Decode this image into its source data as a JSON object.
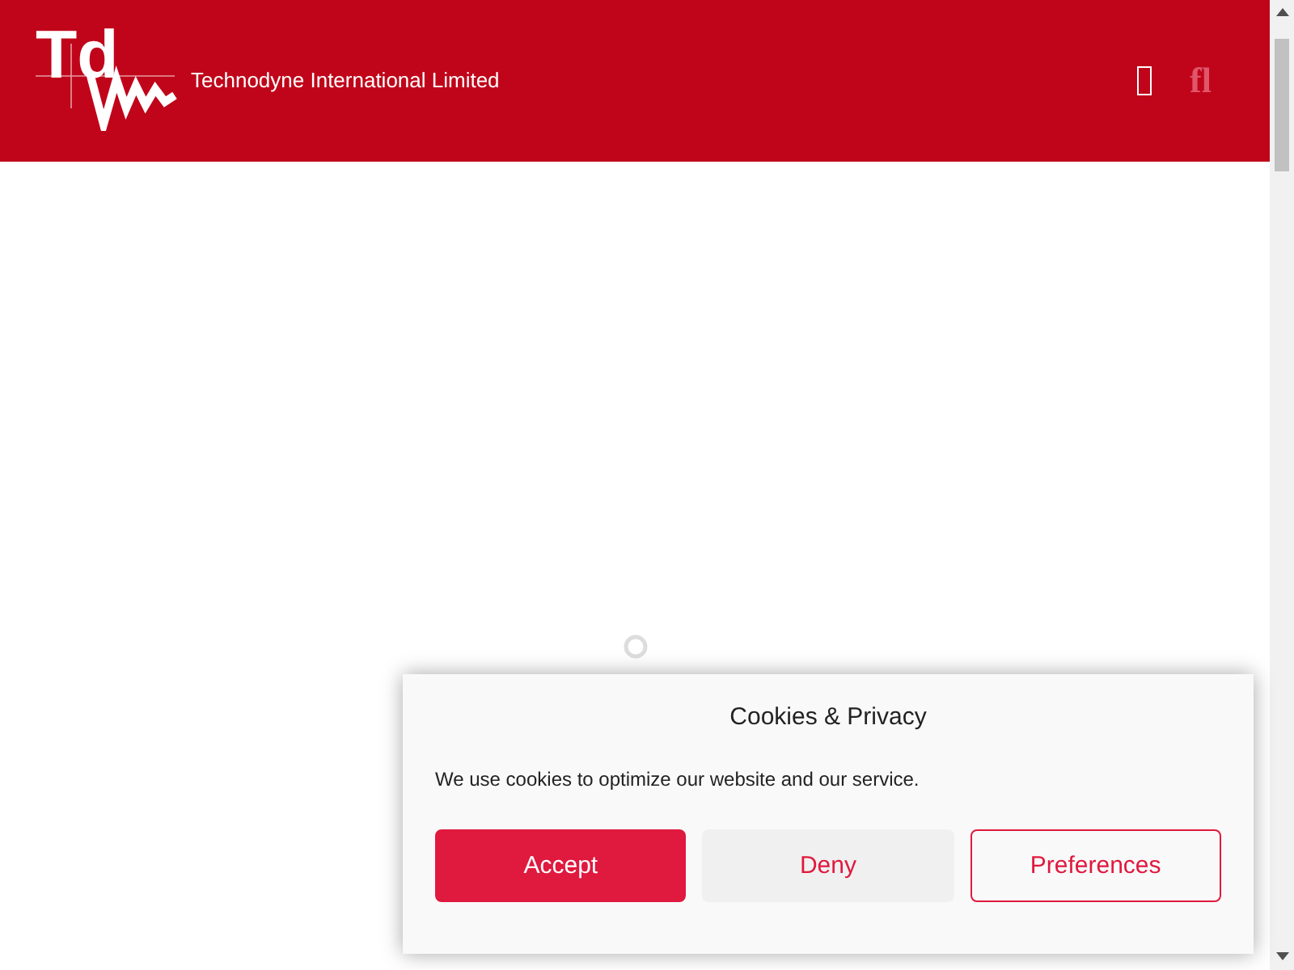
{
  "header": {
    "logo_mark": "Td",
    "company": "Technodyne International Limited",
    "icon_glyph": "fl"
  },
  "cookie_banner": {
    "title": "Cookies & Privacy",
    "message": "We use cookies to optimize our website and our service.",
    "buttons": [
      {
        "label": "Accept",
        "kind": "primary"
      },
      {
        "label": "Deny",
        "kind": "secondary"
      },
      {
        "label": "Preferences",
        "kind": "outline"
      }
    ]
  }
}
